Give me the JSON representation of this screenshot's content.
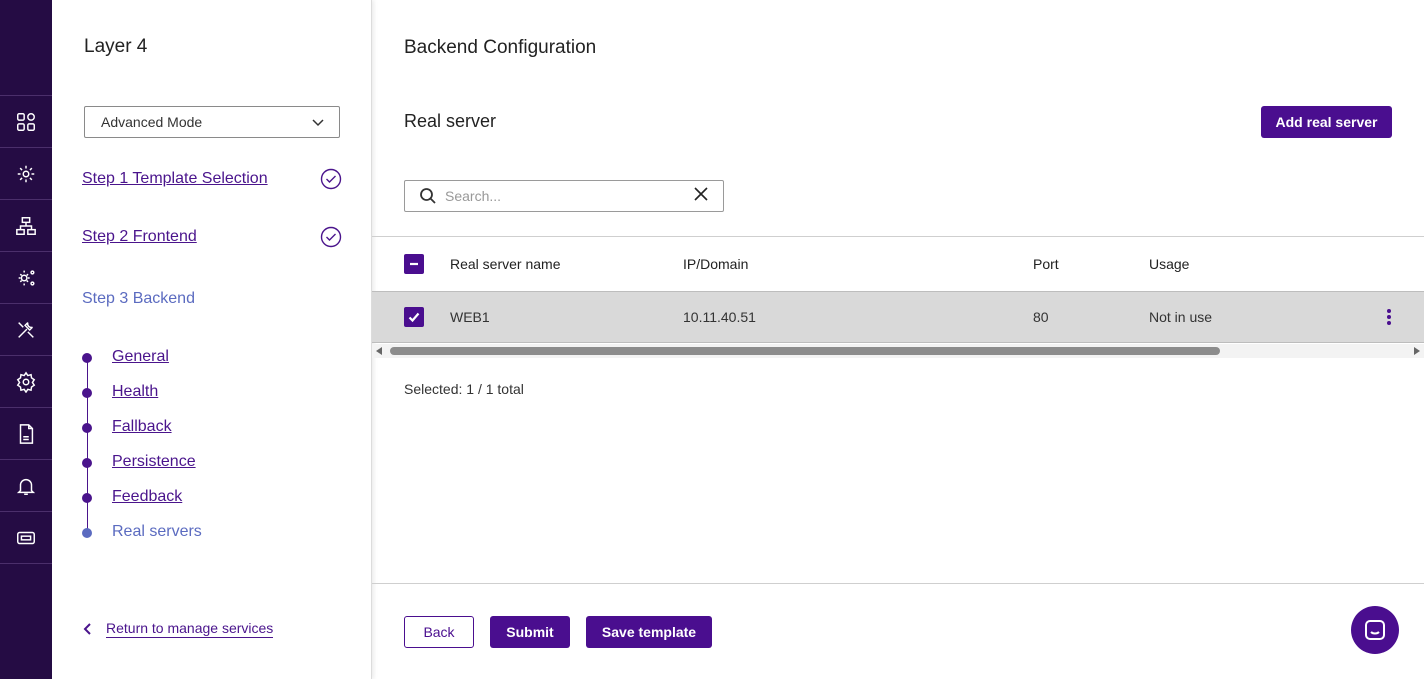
{
  "steps_panel": {
    "title": "Layer 4",
    "mode_select": {
      "value": "Advanced Mode"
    },
    "step1": {
      "label": "Step 1 Template Selection",
      "completed": true
    },
    "step2": {
      "label": "Step 2 Frontend",
      "completed": true
    },
    "step3": {
      "label": "Step 3 Backend",
      "active": true
    },
    "substeps": [
      {
        "label": "General"
      },
      {
        "label": "Health"
      },
      {
        "label": "Fallback"
      },
      {
        "label": "Persistence"
      },
      {
        "label": "Feedback"
      },
      {
        "label": "Real servers",
        "current": true
      }
    ],
    "return_link": "Return to manage services"
  },
  "main": {
    "title": "Backend Configuration",
    "section_title": "Real server",
    "add_button": "Add real server",
    "search": {
      "placeholder": "Search...",
      "value": ""
    },
    "table": {
      "columns": [
        "Real server name",
        "IP/Domain",
        "Port",
        "Usage"
      ],
      "rows": [
        {
          "name": "WEB1",
          "ip": "10.11.40.51",
          "port": "80",
          "usage": "Not in use",
          "selected": true
        }
      ]
    },
    "selected_text": "Selected: 1 / 1 total",
    "footer": {
      "back": "Back",
      "submit": "Submit",
      "save_template": "Save template"
    }
  },
  "colors": {
    "rail_bg": "#250c44",
    "accent": "#4a0e8f",
    "active_step": "#5b6bc0"
  },
  "rail_icons": [
    "dashboard-icon",
    "services-icon",
    "network-icon",
    "cluster-settings-icon",
    "tools-icon",
    "settings-icon",
    "log-icon",
    "bell-icon",
    "ticket-icon"
  ]
}
